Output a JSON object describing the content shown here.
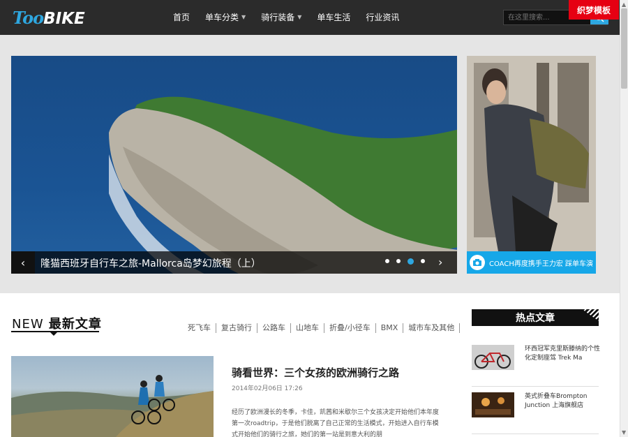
{
  "header": {
    "logo_too": "Too",
    "logo_bike": "BIKE",
    "nav": [
      {
        "label": "首页",
        "dropdown": false
      },
      {
        "label": "单车分类",
        "dropdown": true
      },
      {
        "label": "骑行装备",
        "dropdown": true
      },
      {
        "label": "单车生活",
        "dropdown": false
      },
      {
        "label": "行业资讯",
        "dropdown": false
      }
    ],
    "search_placeholder": "在这里搜索...",
    "badge": "织梦模板"
  },
  "slider": {
    "title": "隆猫西班牙自行车之旅-Mallorca岛梦幻旅程（上）",
    "prev": "‹",
    "next": "›",
    "dots": 4,
    "active_dot": 3
  },
  "side_ad": {
    "caption": "COACH再度携手王力宏 踩单车演"
  },
  "latest": {
    "title_new": "NEW",
    "title_rest": "最新文章",
    "categories": [
      "死飞车",
      "复古骑行",
      "公路车",
      "山地车",
      "折叠/小径车",
      "BMX",
      "城市车及其他"
    ]
  },
  "article": {
    "title": "骑看世界：三个女孩的欧洲骑行之路",
    "date": "2014年02月06日 17:26",
    "excerpt": "经历了欧洲漫长的冬季，卡佳，凯茜和米歇尔三个女孩决定开始他们本年度第一次roadtrip，于是他们脱离了自己正常的生活模式，开始进入自行车模式开始他们的骑行之旅，她们的第一站是到意大利的朋"
  },
  "hot": {
    "title": "热点文章",
    "items": [
      {
        "text": "环西冠军克里斯滕纳的个性化定制座驾 Trek Ma"
      },
      {
        "text": "英式折叠车Brompton Junction 上海旗舰店"
      }
    ]
  },
  "colors": {
    "accent": "#2ea7e0",
    "header_bg": "#2b2b2b",
    "badge": "#e60012",
    "ad_caption": "#16a7e8"
  }
}
